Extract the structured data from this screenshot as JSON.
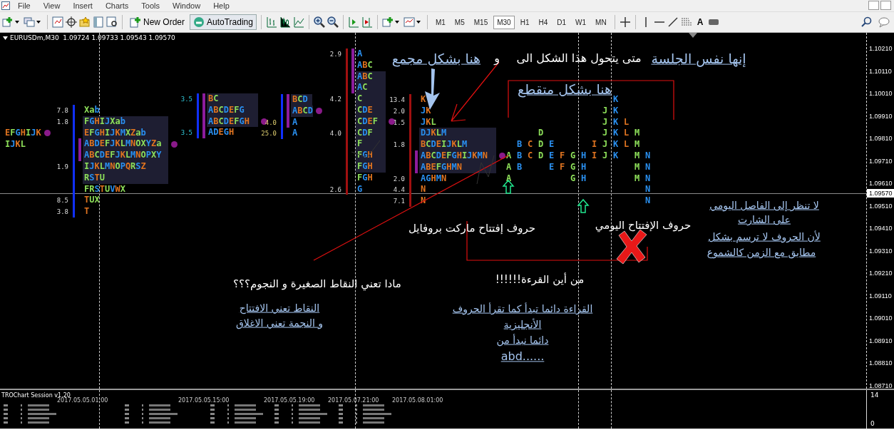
{
  "menu": [
    "File",
    "View",
    "Insert",
    "Charts",
    "Tools",
    "Window",
    "Help"
  ],
  "toolbar": {
    "buttons": [
      "New Order",
      "AutoTrading"
    ],
    "text_tool": "A",
    "timeframes": [
      {
        "label": "M1",
        "selected": false
      },
      {
        "label": "M5",
        "selected": false
      },
      {
        "label": "M15",
        "selected": false
      },
      {
        "label": "M30",
        "selected": true
      },
      {
        "label": "H1",
        "selected": false
      },
      {
        "label": "H4",
        "selected": false
      },
      {
        "label": "D1",
        "selected": false
      },
      {
        "label": "W1",
        "selected": false
      },
      {
        "label": "MN",
        "selected": false
      }
    ]
  },
  "chart": {
    "header": "EURUSDm,M30  1.09724 1.09733 1.09543 1.09570",
    "profiles": [
      {
        "rows": [
          {
            "text": "EFGHIJK",
            "highlighted": false,
            "marked": false,
            "dot": true
          },
          {
            "text": "IJKL",
            "highlighted": false,
            "marked": false,
            "dot": false
          }
        ]
      },
      {
        "rows": [
          {
            "text": "Xab",
            "value": "7.8",
            "highlighted": false,
            "marked": false,
            "dot": false
          },
          {
            "text": "FGHIJXab",
            "value": "1.8",
            "highlighted": true,
            "marked": false,
            "dot": false
          },
          {
            "text": "EFGHIJKMXZab",
            "highlighted": true,
            "marked": false,
            "dot": false
          },
          {
            "text": "ABDEFJKLMNOXYZa",
            "highlighted": true,
            "marked": true,
            "dot": true
          },
          {
            "text": "ABCDEFJKLMNOPXY",
            "highlighted": true,
            "marked": true,
            "dot": false
          },
          {
            "text": "IJKLMNOPQRSZ",
            "value": "1.9",
            "highlighted": true,
            "marked": false,
            "dot": false
          },
          {
            "text": "RSTU",
            "highlighted": true,
            "marked": false,
            "dot": false
          },
          {
            "text": "FRSTUVWX",
            "highlighted": false,
            "marked": false,
            "dot": false
          },
          {
            "text": "TUX",
            "value": "8.5",
            "highlighted": false,
            "marked": false,
            "dot": false
          },
          {
            "text": "T",
            "value": "3.8",
            "highlighted": false,
            "marked": false,
            "dot": false
          }
        ]
      },
      {
        "rows": [
          {
            "text": "BC",
            "value": "3.5",
            "highlighted": true,
            "marked": true,
            "dot": false
          },
          {
            "text": "ABCDEFG",
            "highlighted": true,
            "marked": true,
            "dot": false
          },
          {
            "text": "ABCDEFGH",
            "highlighted": true,
            "marked": true,
            "dot": true
          },
          {
            "text": "ADEGH",
            "value": "3.5",
            "highlighted": false,
            "marked": true,
            "dot": false
          }
        ]
      },
      {
        "rows": [
          {
            "text": "BCD",
            "highlighted": true,
            "marked": true,
            "dot": false
          },
          {
            "text": "ABCD",
            "highlighted": true,
            "marked": true,
            "dot": true
          },
          {
            "text": "A",
            "value": "4.0",
            "highlighted": false,
            "marked": true,
            "dot": false
          },
          {
            "text": "A",
            "value": "25.0",
            "highlighted": false,
            "marked": false,
            "dot": false
          }
        ]
      },
      {
        "rows": [
          {
            "text": "A",
            "value": "2.9",
            "highlighted": false,
            "marked": true,
            "dot": false
          },
          {
            "text": "ABC",
            "highlighted": false,
            "marked": true,
            "dot": false
          },
          {
            "text": "ABC",
            "highlighted": true,
            "marked": true,
            "dot": false
          },
          {
            "text": "AC",
            "highlighted": true,
            "marked": true,
            "dot": false
          },
          {
            "text": "C",
            "value": "4.2",
            "highlighted": true,
            "marked": false,
            "dot": false
          },
          {
            "text": "CDE",
            "highlighted": true,
            "marked": false,
            "dot": false
          },
          {
            "text": "CDEF",
            "highlighted": true,
            "marked": false,
            "dot": true
          },
          {
            "text": "CDF",
            "value": "4.0",
            "highlighted": true,
            "marked": false,
            "dot": false
          },
          {
            "text": "F",
            "highlighted": true,
            "marked": false,
            "dot": false
          },
          {
            "text": "FGH",
            "highlighted": true,
            "marked": false,
            "dot": false
          },
          {
            "text": "FGH",
            "highlighted": true,
            "marked": false,
            "dot": false
          },
          {
            "text": "FGH",
            "highlighted": false,
            "marked": false,
            "dot": false
          },
          {
            "text": "G",
            "value": "2.6",
            "highlighted": false,
            "marked": false,
            "dot": false
          }
        ]
      },
      {
        "rows": [
          {
            "text": "K",
            "value": "13.4",
            "highlighted": false,
            "marked": false,
            "dot": false
          },
          {
            "text": "JK",
            "value": "2.0",
            "highlighted": false,
            "marked": false,
            "dot": false
          },
          {
            "text": "JKL",
            "value": "1.5",
            "highlighted": false,
            "marked": false,
            "dot": false
          },
          {
            "text": "DJKLM",
            "highlighted": true,
            "marked": false,
            "dot": false
          },
          {
            "text": "BCDEIJKLM",
            "value": "1.8",
            "highlighted": true,
            "marked": false,
            "dot": false
          },
          {
            "text": "ABCDEFGHIJKMN",
            "highlighted": true,
            "marked": true,
            "dot": true
          },
          {
            "text": "ABEFGHMN",
            "highlighted": true,
            "marked": true,
            "dot": false
          },
          {
            "text": "AGHMN",
            "value": "2.0",
            "highlighted": false,
            "marked": false,
            "dot": false
          },
          {
            "text": "N",
            "value": "4.4",
            "highlighted": false,
            "marked": false,
            "dot": false
          },
          {
            "text": "N",
            "value": "7.1",
            "highlighted": false,
            "marked": false,
            "dot": false
          }
        ]
      }
    ],
    "split_profile": [
      [
        {
          "kind": "gap"
        },
        {
          "kind": "gap"
        },
        {
          "kind": "gap"
        },
        {
          "kind": "gap"
        },
        {
          "kind": "gap"
        },
        {
          "kind": "gap"
        },
        {
          "kind": "gap"
        },
        {
          "kind": "gap"
        },
        {
          "kind": "gap"
        },
        {
          "kind": "gap"
        },
        {
          "kind": "letter",
          "text": "K"
        }
      ],
      [
        {
          "kind": "gap"
        },
        {
          "kind": "gap"
        },
        {
          "kind": "gap"
        },
        {
          "kind": "gap"
        },
        {
          "kind": "gap"
        },
        {
          "kind": "gap"
        },
        {
          "kind": "gap"
        },
        {
          "kind": "gap"
        },
        {
          "kind": "gap"
        },
        {
          "kind": "letter",
          "text": "J"
        },
        {
          "kind": "letter",
          "text": "K"
        }
      ],
      [
        {
          "kind": "gap"
        },
        {
          "kind": "gap"
        },
        {
          "kind": "gap"
        },
        {
          "kind": "gap"
        },
        {
          "kind": "gap"
        },
        {
          "kind": "gap"
        },
        {
          "kind": "gap"
        },
        {
          "kind": "gap"
        },
        {
          "kind": "gap"
        },
        {
          "kind": "letter",
          "text": "J"
        },
        {
          "kind": "letter",
          "text": "K"
        },
        {
          "kind": "letter",
          "text": "L"
        }
      ],
      [
        {
          "kind": "gap"
        },
        {
          "kind": "gap"
        },
        {
          "kind": "gap"
        },
        {
          "kind": "letter",
          "text": "D"
        },
        {
          "kind": "gap"
        },
        {
          "kind": "gap"
        },
        {
          "kind": "gap"
        },
        {
          "kind": "gap"
        },
        {
          "kind": "gap"
        },
        {
          "kind": "letter",
          "text": "J"
        },
        {
          "kind": "letter",
          "text": "K"
        },
        {
          "kind": "letter",
          "text": "L"
        },
        {
          "kind": "letter",
          "text": "M"
        }
      ],
      [
        {
          "kind": "gap"
        },
        {
          "kind": "letter",
          "text": "B"
        },
        {
          "kind": "letter",
          "text": "C"
        },
        {
          "kind": "letter",
          "text": "D"
        },
        {
          "kind": "letter",
          "text": "E"
        },
        {
          "kind": "gap"
        },
        {
          "kind": "gap"
        },
        {
          "kind": "gap"
        },
        {
          "kind": "letter",
          "text": "I"
        },
        {
          "kind": "letter",
          "text": "J"
        },
        {
          "kind": "letter",
          "text": "K"
        },
        {
          "kind": "letter",
          "text": "L"
        },
        {
          "kind": "letter",
          "text": "M"
        }
      ],
      [
        {
          "kind": "letter",
          "text": "A"
        },
        {
          "kind": "letter",
          "text": "B"
        },
        {
          "kind": "letter",
          "text": "C"
        },
        {
          "kind": "letter",
          "text": "D"
        },
        {
          "kind": "letter",
          "text": "E"
        },
        {
          "kind": "letter",
          "text": "F"
        },
        {
          "kind": "letter",
          "text": "G"
        },
        {
          "kind": "letter",
          "text": "H"
        },
        {
          "kind": "letter",
          "text": "I"
        },
        {
          "kind": "letter",
          "text": "J"
        },
        {
          "kind": "letter",
          "text": "K"
        },
        {
          "kind": "gap"
        },
        {
          "kind": "letter",
          "text": "M"
        },
        {
          "kind": "letter",
          "text": "N"
        }
      ],
      [
        {
          "kind": "letter",
          "text": "A"
        },
        {
          "kind": "letter",
          "text": "B"
        },
        {
          "kind": "gap"
        },
        {
          "kind": "gap"
        },
        {
          "kind": "letter",
          "text": "E"
        },
        {
          "kind": "letter",
          "text": "F"
        },
        {
          "kind": "letter",
          "text": "G"
        },
        {
          "kind": "letter",
          "text": "H"
        },
        {
          "kind": "gap"
        },
        {
          "kind": "gap"
        },
        {
          "kind": "gap"
        },
        {
          "kind": "gap"
        },
        {
          "kind": "letter",
          "text": "M"
        },
        {
          "kind": "letter",
          "text": "N"
        }
      ],
      [
        {
          "kind": "letter",
          "text": "A"
        },
        {
          "kind": "gap"
        },
        {
          "kind": "gap"
        },
        {
          "kind": "gap"
        },
        {
          "kind": "gap"
        },
        {
          "kind": "gap"
        },
        {
          "kind": "letter",
          "text": "G"
        },
        {
          "kind": "letter",
          "text": "H"
        },
        {
          "kind": "gap"
        },
        {
          "kind": "gap"
        },
        {
          "kind": "gap"
        },
        {
          "kind": "gap"
        },
        {
          "kind": "letter",
          "text": "M"
        },
        {
          "kind": "letter",
          "text": "N"
        }
      ],
      [
        {
          "kind": "gap"
        },
        {
          "kind": "gap"
        },
        {
          "kind": "gap"
        },
        {
          "kind": "gap"
        },
        {
          "kind": "gap"
        },
        {
          "kind": "gap"
        },
        {
          "kind": "gap"
        },
        {
          "kind": "gap"
        },
        {
          "kind": "gap"
        },
        {
          "kind": "gap"
        },
        {
          "kind": "gap"
        },
        {
          "kind": "gap"
        },
        {
          "kind": "gap"
        },
        {
          "kind": "letter",
          "text": "N"
        }
      ],
      [
        {
          "kind": "gap"
        },
        {
          "kind": "gap"
        },
        {
          "kind": "gap"
        },
        {
          "kind": "gap"
        },
        {
          "kind": "gap"
        },
        {
          "kind": "gap"
        },
        {
          "kind": "gap"
        },
        {
          "kind": "gap"
        },
        {
          "kind": "gap"
        },
        {
          "kind": "gap"
        },
        {
          "kind": "gap"
        },
        {
          "kind": "gap"
        },
        {
          "kind": "gap"
        },
        {
          "kind": "letter",
          "text": "N"
        }
      ]
    ],
    "annotations": [
      {
        "text": "إنها نفس الجلسة",
        "kind": "underlined"
      },
      {
        "text": "متى يتحول هذا الشكل الى",
        "kind": "plain"
      },
      {
        "text": "و",
        "kind": "plain"
      },
      {
        "text": "هنا بشكل مجمع",
        "kind": "underlined"
      },
      {
        "text": "هنا بشكل متقطع",
        "kind": "underlined"
      },
      {
        "text": "حروف الإفتتاح اليومي",
        "kind": "plain"
      },
      {
        "text": "حروف إفتتاح ماركت بروفايل",
        "kind": "plain"
      },
      {
        "text": "لا تنظر إلى الفاصل اليومي",
        "kind": "underlined"
      },
      {
        "text": "على الشارت",
        "kind": "underlined"
      },
      {
        "text": "لأن الحروف لا ترسم بشكل",
        "kind": "underlined"
      },
      {
        "text": "مطابق مع الزمن كالشموع",
        "kind": "underlined"
      },
      {
        "text": "مادا تعني النقاط الصغيرة و النجوم؟؟؟",
        "kind": "plain"
      },
      {
        "text": "النقاط تعني الافتتاح",
        "kind": "underlined"
      },
      {
        "text": "و النجمة تعني الاغلاق",
        "kind": "underlined"
      },
      {
        "text": "من أين القرءة!!!!!!",
        "kind": "plain"
      },
      {
        "text": "القراءة دائما تبدأ كما تقرأ الحروف",
        "kind": "underlined"
      },
      {
        "text": "الأنجليزية",
        "kind": "underlined"
      },
      {
        "text": "دائما نبدأ من",
        "kind": "underlined"
      },
      {
        "text": "abd......",
        "kind": "underlined"
      }
    ],
    "price_axis": {
      "labels": [
        "1.10210",
        "1.10110",
        "1.10010",
        "1.09910",
        "1.09810",
        "1.09710",
        "1.09610",
        "1.09510",
        "1.09410",
        "1.09310",
        "1.09210",
        "1.09110",
        "1.09010",
        "1.08910",
        "1.08810",
        "1.08710"
      ],
      "current": "1.09570"
    }
  },
  "indicator": {
    "title": "TROChart Session v1.20",
    "sessions": [
      "2017.05.05.01:00",
      "2017.05.05.15:00",
      "2017.05.05.19:00",
      "2017.05.07.21:00",
      "2017.05.08.01:00"
    ],
    "axis": [
      "14",
      "0"
    ]
  }
}
